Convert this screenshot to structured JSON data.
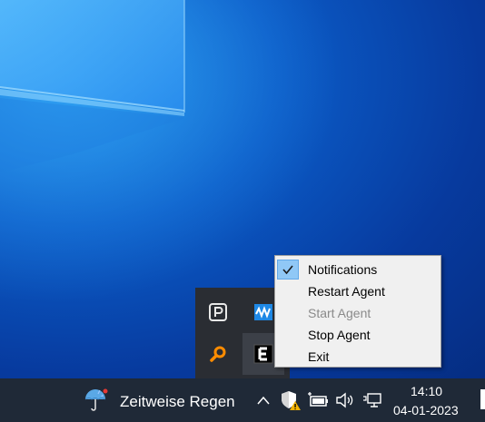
{
  "context_menu": {
    "items": [
      {
        "label": "Notifications",
        "checked": true,
        "enabled": true
      },
      {
        "label": "Restart Agent",
        "checked": false,
        "enabled": true
      },
      {
        "label": "Start Agent",
        "checked": false,
        "enabled": false
      },
      {
        "label": "Stop Agent",
        "checked": false,
        "enabled": true
      },
      {
        "label": "Exit",
        "checked": false,
        "enabled": true
      }
    ]
  },
  "tray_overflow": {
    "icons": [
      {
        "name": "p-app-icon"
      },
      {
        "name": "waves-audio-icon",
        "color": "#1e88e5"
      },
      {
        "name": "magnifier-icon",
        "color": "#ff8c00"
      },
      {
        "name": "e-agent-icon"
      }
    ]
  },
  "taskbar": {
    "weather": {
      "text": "Zeitweise Regen",
      "icon": "umbrella-rain-icon"
    },
    "clock": {
      "time": "14:10",
      "date": "04-01-2023"
    },
    "tray_icons": [
      "chevron-up-icon",
      "shield-warning-icon",
      "battery-plug-icon",
      "speaker-icon",
      "network-icon"
    ]
  },
  "colors": {
    "desktop": "#0b5cc8",
    "taskbar": "#1f2937",
    "menu_bg": "#f0f0f0",
    "check_highlight": "#90c8f6",
    "disabled_text": "#8a8a8a"
  }
}
